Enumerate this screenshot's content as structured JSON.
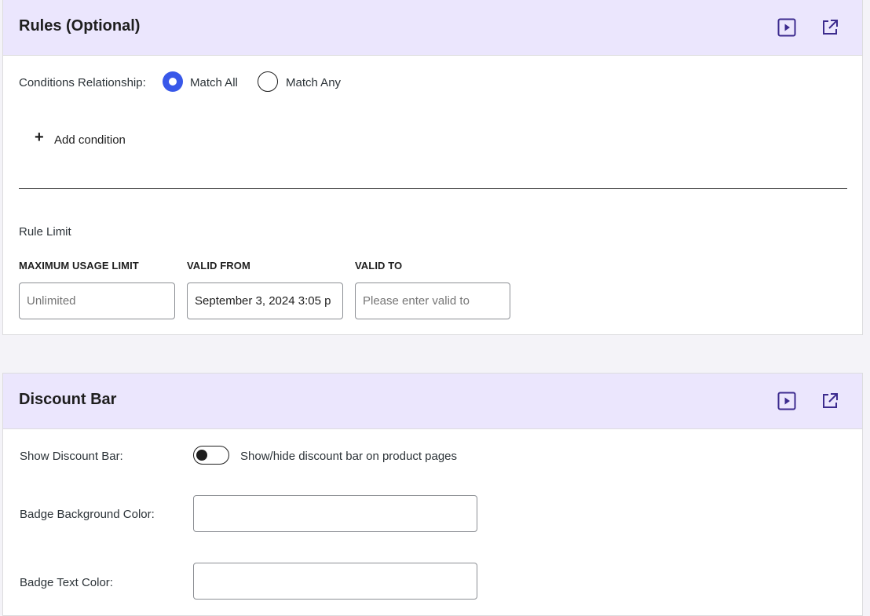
{
  "rules": {
    "title": "Rules (Optional)",
    "conditions_label": "Conditions Relationship:",
    "match_all": "Match All",
    "match_any": "Match Any",
    "selected": "match_all",
    "add_condition": "Add condition",
    "rule_limit": "Rule Limit",
    "max_usage": {
      "label": "MAXIMUM USAGE LIMIT",
      "value": "",
      "placeholder": "Unlimited"
    },
    "valid_from": {
      "label": "VALID FROM",
      "value": "September 3, 2024 3:05 p",
      "placeholder": ""
    },
    "valid_to": {
      "label": "VALID TO",
      "value": "",
      "placeholder": "Please enter valid to"
    }
  },
  "discount_bar": {
    "title": "Discount Bar",
    "show_label": "Show Discount Bar:",
    "show_enabled": false,
    "show_help": "Show/hide discount bar on product pages",
    "badge_bg_label": "Badge Background Color:",
    "badge_bg_value": "",
    "badge_text_label": "Badge Text Color:",
    "badge_text_value": ""
  },
  "colors": {
    "header_bg": "#ebe6fd",
    "accent": "#3858e9",
    "icon": "#3c2b8e"
  }
}
